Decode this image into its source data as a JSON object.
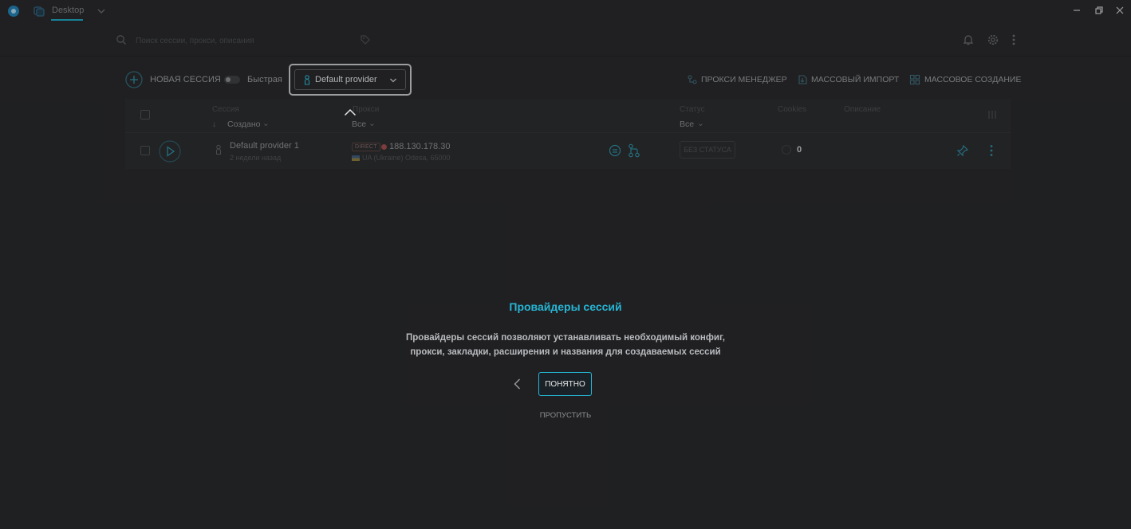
{
  "titlebar": {
    "workspace_name": "Desktop",
    "icons": [
      "app-logo",
      "workspace-icon",
      "chevron-down-icon",
      "minimize-icon",
      "restore-icon",
      "close-icon"
    ]
  },
  "topbar": {
    "search_placeholder": "Поиск сессии, прокси, описания",
    "icons": [
      "search-icon",
      "tag-icon",
      "bell-icon",
      "gear-icon",
      "kebab-icon"
    ]
  },
  "toolbar": {
    "new_session_label": "НОВАЯ СЕССИЯ",
    "quick_label": "Быстрая",
    "quick_toggle_on": false,
    "provider_label": "Default provider",
    "proxy_manager_label": "ПРОКСИ МЕНЕДЖЕР",
    "mass_import_label": "МАССОВЫЙ ИМПОРТ",
    "mass_create_label": "МАССОВОЕ СОЗДАНИЕ"
  },
  "table": {
    "headers": {
      "session": "Сессия",
      "proxy": "Прокси",
      "status": "Статус",
      "cookies": "Cookies",
      "description": "Описание"
    },
    "filters": {
      "sort_label": "Создано",
      "proxy_filter": "Все",
      "status_filter": "Все"
    },
    "rows": [
      {
        "name": "Default provider 1",
        "created": "2 недели назад",
        "proxy_type": "DIRECT",
        "proxy_ip": "188.130.178.30",
        "proxy_geo": "UA (Ukraine) Odesa, 65000",
        "status": "БЕЗ СТАТУСА",
        "cookies": "0"
      }
    ]
  },
  "onboarding": {
    "title": "Провайдеры сессий",
    "body_line1": "Провайдеры сессий позволяют устанавливать необходимый конфиг,",
    "body_line2": "прокси, закладки, расширения и названия для создаваемых сессий",
    "ok_label": "ПОНЯТНО",
    "skip_label": "ПРОПУСТИТЬ"
  },
  "colors": {
    "background": "#242527",
    "accent": "#26b5d4",
    "text": "#d4d6d8",
    "proxy_dead": "#9e4a4a"
  }
}
